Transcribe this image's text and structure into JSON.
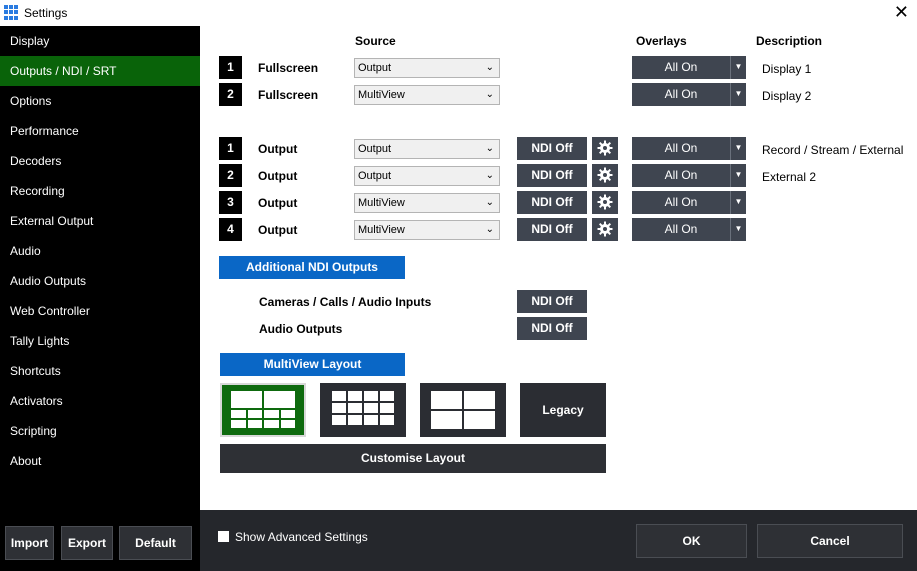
{
  "window": {
    "title": "Settings",
    "close_glyph": "✕"
  },
  "sidebar": {
    "items": [
      {
        "label": "Display"
      },
      {
        "label": "Outputs / NDI / SRT",
        "active": true
      },
      {
        "label": "Options"
      },
      {
        "label": "Performance"
      },
      {
        "label": "Decoders"
      },
      {
        "label": "Recording"
      },
      {
        "label": "External Output"
      },
      {
        "label": "Audio"
      },
      {
        "label": "Audio Outputs"
      },
      {
        "label": "Web Controller"
      },
      {
        "label": "Tally Lights"
      },
      {
        "label": "Shortcuts"
      },
      {
        "label": "Activators"
      },
      {
        "label": "Scripting"
      },
      {
        "label": "About"
      }
    ],
    "buttons": {
      "import": "Import",
      "export": "Export",
      "default": "Default"
    }
  },
  "headers": {
    "source": "Source",
    "overlays": "Overlays",
    "description": "Description"
  },
  "fullscreen_rows": [
    {
      "num": "1",
      "label": "Fullscreen",
      "source": "Output",
      "overlay": "All On",
      "description": "Display 1"
    },
    {
      "num": "2",
      "label": "Fullscreen",
      "source": "MultiView",
      "overlay": "All On",
      "description": "Display 2"
    }
  ],
  "output_rows": [
    {
      "num": "1",
      "label": "Output",
      "source": "Output",
      "ndi": "NDI Off",
      "overlay": "All On",
      "description": "Record / Stream / External"
    },
    {
      "num": "2",
      "label": "Output",
      "source": "Output",
      "ndi": "NDI Off",
      "overlay": "All On",
      "description": "External 2"
    },
    {
      "num": "3",
      "label": "Output",
      "source": "MultiView",
      "ndi": "NDI Off",
      "overlay": "All On",
      "description": ""
    },
    {
      "num": "4",
      "label": "Output",
      "source": "MultiView",
      "ndi": "NDI Off",
      "overlay": "All On",
      "description": ""
    }
  ],
  "additional_ndi": {
    "title": "Additional NDI Outputs",
    "rows": [
      {
        "label": "Cameras / Calls / Audio Inputs",
        "ndi": "NDI Off"
      },
      {
        "label": "Audio Outputs",
        "ndi": "NDI Off"
      }
    ]
  },
  "multiview": {
    "title": "MultiView Layout",
    "layouts": [
      {
        "name": "layout-1-large-8-small",
        "selected": true
      },
      {
        "name": "layout-grid-12"
      },
      {
        "name": "layout-grid-4"
      },
      {
        "name": "legacy",
        "label": "Legacy"
      }
    ],
    "customise_label": "Customise Layout"
  },
  "footer": {
    "show_advanced_label": "Show Advanced Settings",
    "show_advanced_checked": false,
    "ok_label": "OK",
    "cancel_label": "Cancel"
  },
  "colors": {
    "accent_green": "#096309",
    "button_dark": "#3f4550",
    "button_blue": "#0a67c6",
    "footer_bg": "#25272c"
  }
}
